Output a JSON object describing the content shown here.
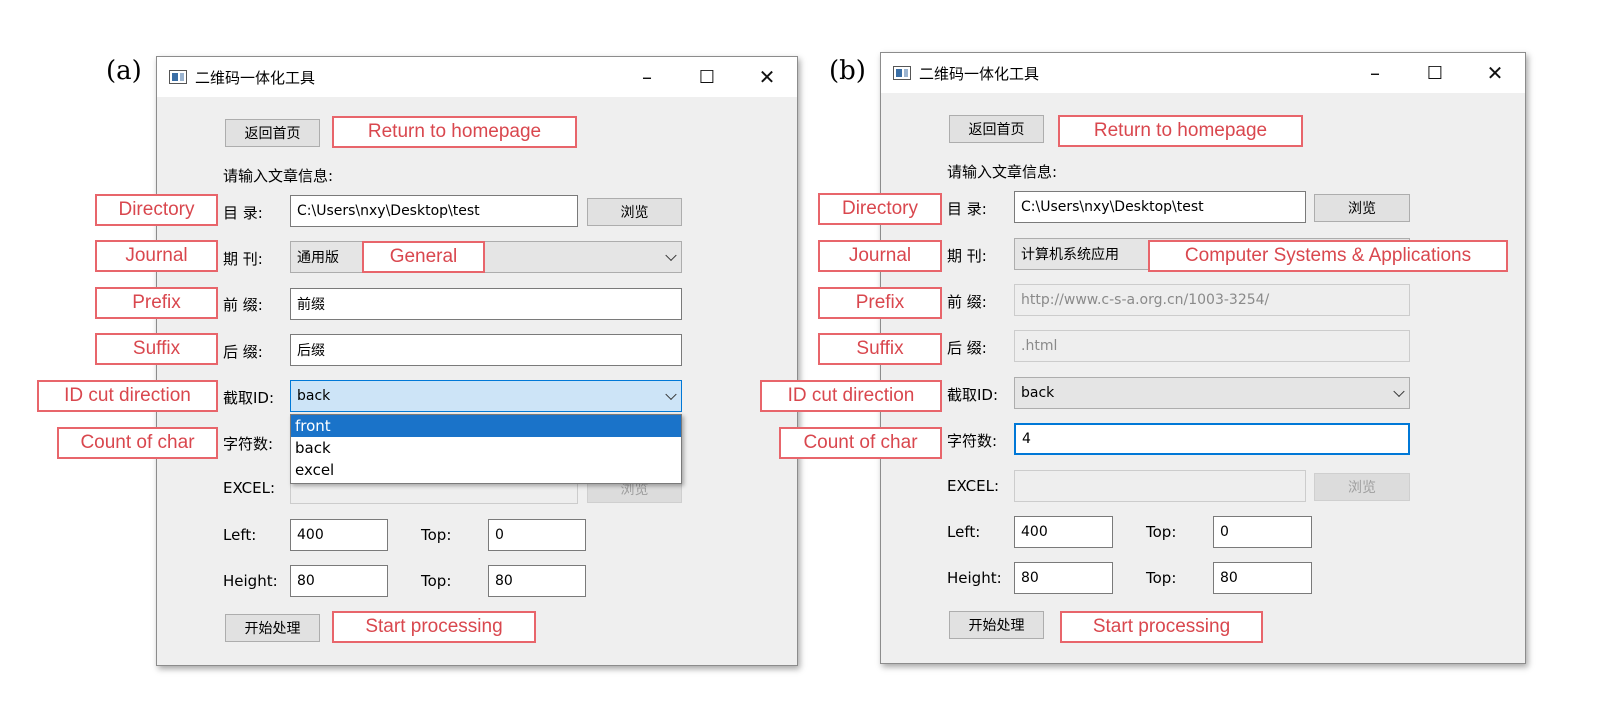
{
  "panels": [
    {
      "label": "(a)",
      "window_title": "二维码一体化工具",
      "back_button": "返回首页",
      "prompt": "请输入文章信息:",
      "directory_label": "目 录:",
      "directory_value": "C:\\Users\\nxy\\Desktop\\test",
      "browse_label": "浏览",
      "journal_label": "期 刊:",
      "journal_value": "通用版",
      "prefix_label": "前 缀:",
      "prefix_value": "前缀",
      "suffix_label": "后 缀:",
      "suffix_value": "后缀",
      "idcut_label": "截取ID:",
      "idcut_value": "back",
      "count_label": "字符数:",
      "count_value": "",
      "excel_label": "EXCEL:",
      "excel_browse": "浏览",
      "left_label": "Left:",
      "left_value": "400",
      "top1_label": "Top:",
      "top1_value": "0",
      "height_label": "Height:",
      "height_value": "80",
      "top2_label": "Top:",
      "top2_value": "80",
      "start_button": "开始处理",
      "dropdown_options": [
        "front",
        "back",
        "excel"
      ],
      "annotations": {
        "return": "Return to homepage",
        "directory": "Directory",
        "journal": "Journal",
        "journal_value": "General",
        "prefix": "Prefix",
        "suffix": "Suffix",
        "idcut": "ID cut direction",
        "count": "Count of char",
        "start": "Start processing"
      }
    },
    {
      "label": "(b)",
      "window_title": "二维码一体化工具",
      "back_button": "返回首页",
      "prompt": "请输入文章信息:",
      "directory_label": "目 录:",
      "directory_value": "C:\\Users\\nxy\\Desktop\\test",
      "browse_label": "浏览",
      "journal_label": "期 刊:",
      "journal_value": "计算机系统应用",
      "prefix_label": "前 缀:",
      "prefix_value": "http://www.c-s-a.org.cn/1003-3254/",
      "suffix_label": "后 缀:",
      "suffix_value": ".html",
      "idcut_label": "截取ID:",
      "idcut_value": "back",
      "count_label": "字符数:",
      "count_value": "4",
      "excel_label": "EXCEL:",
      "excel_browse": "浏览",
      "left_label": "Left:",
      "left_value": "400",
      "top1_label": "Top:",
      "top1_value": "0",
      "height_label": "Height:",
      "height_value": "80",
      "top2_label": "Top:",
      "top2_value": "80",
      "start_button": "开始处理",
      "annotations": {
        "return": "Return to homepage",
        "directory": "Directory",
        "journal": "Journal",
        "journal_value": "Computer Systems & Applications",
        "prefix": "Prefix",
        "suffix": "Suffix",
        "idcut": "ID cut direction",
        "count": "Count of char",
        "start": "Start processing"
      }
    }
  ],
  "window_controls": {
    "minimize": "–",
    "maximize": "☐",
    "close": "✕"
  },
  "colors": {
    "annotation": "#e8656b",
    "focus": "#0078d7",
    "selection": "#1a73c9"
  }
}
